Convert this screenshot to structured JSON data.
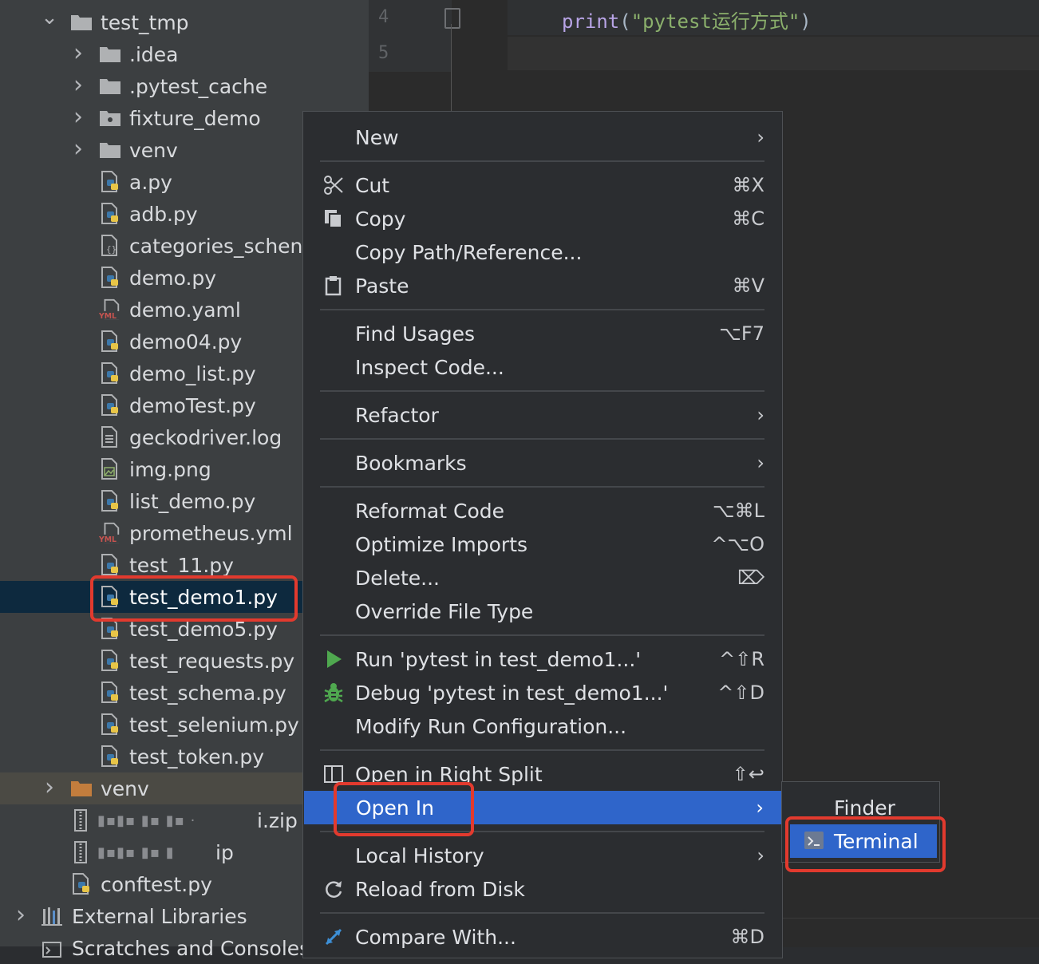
{
  "project_tree": {
    "rows": [
      {
        "label": "test_tmp",
        "kind": "folder",
        "expanded": true
      },
      {
        "label": ".idea",
        "kind": "folder",
        "expanded": false
      },
      {
        "label": ".pytest_cache",
        "kind": "folder",
        "expanded": false
      },
      {
        "label": "fixture_demo",
        "kind": "package",
        "expanded": false
      },
      {
        "label": "venv",
        "kind": "folder",
        "expanded": false
      },
      {
        "label": "a.py",
        "kind": "python"
      },
      {
        "label": "adb.py",
        "kind": "python"
      },
      {
        "label": "categories_schen",
        "kind": "json"
      },
      {
        "label": "demo.py",
        "kind": "python"
      },
      {
        "label": "demo.yaml",
        "kind": "yaml"
      },
      {
        "label": "demo04.py",
        "kind": "python"
      },
      {
        "label": "demo_list.py",
        "kind": "python"
      },
      {
        "label": "demoTest.py",
        "kind": "python"
      },
      {
        "label": "geckodriver.log",
        "kind": "text"
      },
      {
        "label": "img.png",
        "kind": "image"
      },
      {
        "label": "list_demo.py",
        "kind": "python"
      },
      {
        "label": "prometheus.yml",
        "kind": "yaml"
      },
      {
        "label": "test_11.py",
        "kind": "python"
      },
      {
        "label": "test_demo1.py",
        "kind": "python",
        "selected": true
      },
      {
        "label": "test_demo5.py",
        "kind": "python"
      },
      {
        "label": "test_requests.py",
        "kind": "python"
      },
      {
        "label": "test_schema.py",
        "kind": "python"
      },
      {
        "label": "test_selenium.py",
        "kind": "python"
      },
      {
        "label": "test_token.py",
        "kind": "python"
      },
      {
        "label": "venv",
        "kind": "folder-orange",
        "expanded": false
      },
      {
        "label": "i.zip",
        "kind": "zip"
      },
      {
        "label": "ip",
        "kind": "zip"
      },
      {
        "label": "conftest.py",
        "kind": "python"
      },
      {
        "label": "External Libraries",
        "kind": "library",
        "expanded": false
      },
      {
        "label": "Scratches and Consoles",
        "kind": "scratch"
      }
    ]
  },
  "editor": {
    "line_numbers": [
      "4",
      "5"
    ],
    "code_keyword": "print",
    "code_open": "(",
    "code_string": "\"pytest运行方式\"",
    "code_close": ")"
  },
  "context_menu": {
    "items": {
      "new": {
        "label": "New"
      },
      "cut": {
        "label": "Cut",
        "shortcut": "⌘X"
      },
      "copy": {
        "label": "Copy",
        "shortcut": "⌘C"
      },
      "copy_path": {
        "label": "Copy Path/Reference..."
      },
      "paste": {
        "label": "Paste",
        "shortcut": "⌘V"
      },
      "find_usages": {
        "label": "Find Usages",
        "shortcut": "⌥F7"
      },
      "inspect_code": {
        "label": "Inspect Code..."
      },
      "refactor": {
        "label": "Refactor"
      },
      "bookmarks": {
        "label": "Bookmarks"
      },
      "reformat_code": {
        "label": "Reformat Code",
        "shortcut": "⌥⌘L"
      },
      "optimize_imports": {
        "label": "Optimize Imports",
        "shortcut": "^⌥O"
      },
      "delete": {
        "label": "Delete...",
        "shortcut": "⌦"
      },
      "override_file_type": {
        "label": "Override File Type"
      },
      "run": {
        "label": "Run 'pytest in test_demo1...'",
        "shortcut": "^⇧R"
      },
      "debug": {
        "label": "Debug 'pytest in test_demo1...'",
        "shortcut": "^⇧D"
      },
      "modify_run": {
        "label": "Modify Run Configuration..."
      },
      "open_right_split": {
        "label": "Open in Right Split",
        "shortcut": "⇧↩"
      },
      "open_in": {
        "label": "Open In"
      },
      "local_history": {
        "label": "Local History"
      },
      "reload": {
        "label": "Reload from Disk"
      },
      "compare_with": {
        "label": "Compare With...",
        "shortcut": "⌘D"
      }
    }
  },
  "submenu": {
    "finder": "Finder",
    "terminal": "Terminal"
  },
  "colors": {
    "highlight_box": "#e23a2e",
    "menu_active": "#2f65ca",
    "run_icon": "#4fa84f",
    "debug_icon": "#4fa84f"
  }
}
